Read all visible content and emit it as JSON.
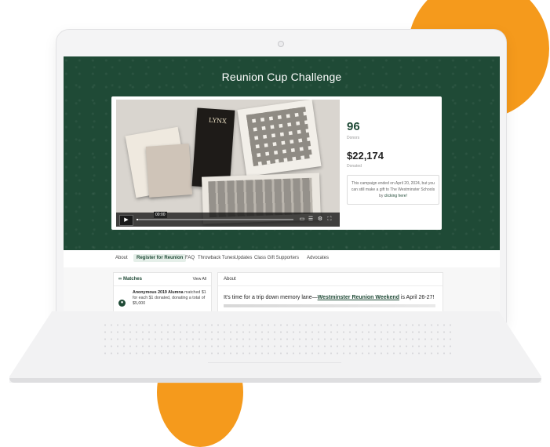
{
  "hero": {
    "title": "Reunion Cup Challenge"
  },
  "video": {
    "cover_text": "LYNX",
    "timestamp": "00:00",
    "progress_fraction": 0.01
  },
  "stats": {
    "donors_count": "96",
    "donors_label": "Donors",
    "donated_amount": "$22,174",
    "donated_label": "Donated",
    "ended_text": "This campaign ended on April 20, 2024, but you can still make a gift to The Westminster Schools by",
    "ended_link": "clicking here!"
  },
  "tabs": [
    {
      "label": "About"
    },
    {
      "label": "Register for Reunion",
      "active": true
    },
    {
      "label": "FAQ"
    },
    {
      "label": "Throwback Tunes"
    },
    {
      "label": "Updates"
    },
    {
      "label": "Class Gift Supporters"
    },
    {
      "label": "Advocates"
    }
  ],
  "matches": {
    "title": "∞ Matches",
    "view_all": "View All",
    "item_name": "Anonymous 2019 Alumna",
    "item_text": "matched $1 for each $1 donated, donating a total of $5,000"
  },
  "about": {
    "heading": "About",
    "lead_prefix": "It's time for a trip down memory lane—",
    "lead_link": "Westminster Reunion Weekend",
    "lead_suffix": " is April 26-27!"
  },
  "colors": {
    "brand_green": "#1f4a36",
    "accent_orange": "#f59a1c"
  }
}
